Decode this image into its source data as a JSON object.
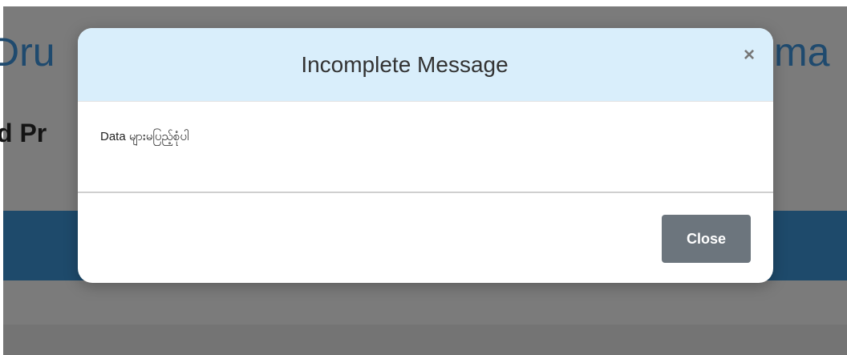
{
  "background": {
    "title_left": "Dru",
    "title_right": "ma",
    "subtitle_left": "d Pr"
  },
  "modal": {
    "title": "Incomplete Message",
    "close_symbol": "×",
    "message": "Data များမပြည့်စုံပါ",
    "close_button_label": "Close"
  },
  "colors": {
    "overlay": "#7b7b7b",
    "header_bg": "#d9eefb",
    "navbar": "#1e4a6b",
    "close_button": "#6c757d"
  }
}
